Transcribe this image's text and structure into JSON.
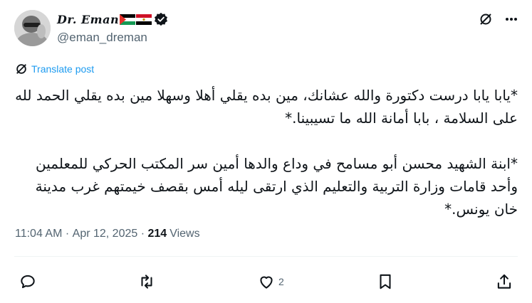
{
  "author": {
    "display_name": "Dr. Eman",
    "handle": "@eman_dreman",
    "flags": [
      "palestine-flag",
      "egypt-flag"
    ],
    "verified_icon": "verified-badge-icon"
  },
  "header_actions": [
    "grok-icon",
    "more-icon"
  ],
  "translate": {
    "label": "Translate post"
  },
  "post": {
    "paragraph_1": "*يابا يابا درست دكتورة والله عشانك، مين بده يقلي أهلا وسهلا مين بده يقلي الحمد لله على السلامة ، بابا أمانة الله ما تسيبينا.*",
    "paragraph_2": "*ابنة الشهيد محسن أبو مسامح في وداع والدها أمين سر المكتب الحركي للمعلمين وأحد قامات وزارة التربية والتعليم الذي ارتقى ليله أمس بقصف خيمتهم غرب مدينة خان يونس.*"
  },
  "meta": {
    "time": "11:04 AM",
    "date": "Apr 12, 2025",
    "views_count": "214",
    "views_label": "Views"
  },
  "actions": {
    "reply": {
      "icon": "reply-icon"
    },
    "repost": {
      "icon": "repost-icon"
    },
    "like": {
      "icon": "heart-icon",
      "count": "2"
    },
    "bookmark": {
      "icon": "bookmark-icon"
    },
    "share": {
      "icon": "share-icon"
    }
  },
  "colors": {
    "accent": "#1d9bf0",
    "secondary_text": "#536471",
    "primary_text": "#0f1419"
  }
}
